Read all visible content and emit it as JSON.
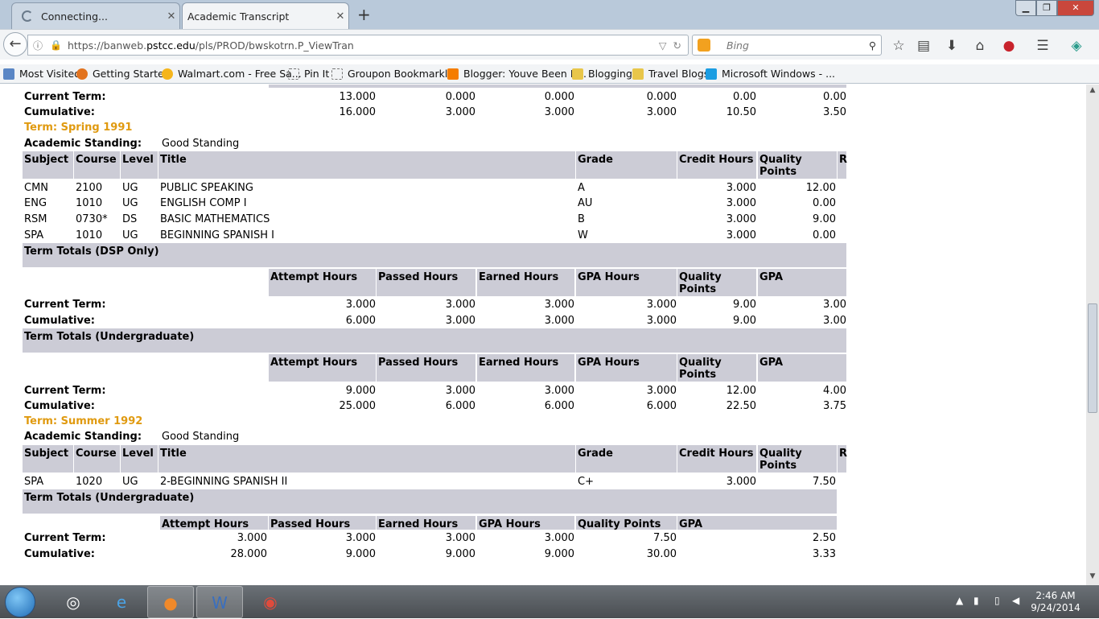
{
  "browser": {
    "tabs": [
      {
        "label": "Connecting...",
        "active": false
      },
      {
        "label": "Academic Transcript",
        "active": true
      }
    ],
    "url_prefix": "https://banweb.",
    "url_domain": "pstcc.edu",
    "url_path": "/pls/PROD/bwskotrn.P_ViewTran",
    "search_placeholder": "Bing",
    "bookmarks": [
      "Most Visited",
      "Getting Started",
      "Walmart.com - Free Sa...",
      "Pin It",
      "Groupon Bookmarklet",
      "Blogger: Youve Been R...",
      "Blogging",
      "Travel Blogs",
      "Microsoft Windows - ..."
    ]
  },
  "transcript": {
    "top_totals": {
      "current_label": "Current Term:",
      "current": [
        "13.000",
        "0.000",
        "0.000",
        "0.000",
        "0.00",
        "0.00"
      ],
      "cumulative_label": "Cumulative:",
      "cumulative": [
        "16.000",
        "3.000",
        "3.000",
        "3.000",
        "10.50",
        "3.50"
      ]
    },
    "terms": [
      {
        "name": "Term: Spring 1991",
        "standing_label": "Academic Standing:",
        "standing": "Good Standing",
        "course_headers": [
          "Subject",
          "Course",
          "Level",
          "Title",
          "Grade",
          "Credit Hours",
          "Quality Points",
          "R"
        ],
        "courses": [
          {
            "subject": "CMN",
            "course": "2100",
            "level": "UG",
            "title": "PUBLIC SPEAKING",
            "grade": "A",
            "credit": "3.000",
            "quality": "12.00"
          },
          {
            "subject": "ENG",
            "course": "1010",
            "level": "UG",
            "title": "ENGLISH COMP I",
            "grade": "AU",
            "credit": "3.000",
            "quality": "0.00"
          },
          {
            "subject": "RSM",
            "course": "0730*",
            "level": "DS",
            "title": "BASIC MATHEMATICS",
            "grade": "B",
            "credit": "3.000",
            "quality": "9.00"
          },
          {
            "subject": "SPA",
            "course": "1010",
            "level": "UG",
            "title": "BEGINNING SPANISH I",
            "grade": "W",
            "credit": "3.000",
            "quality": "0.00"
          }
        ],
        "totals": [
          {
            "title": "Term Totals (DSP Only)",
            "headers": [
              "Attempt Hours",
              "Passed Hours",
              "Earned Hours",
              "GPA Hours",
              "Quality Points",
              "GPA"
            ],
            "current_label": "Current Term:",
            "current": [
              "3.000",
              "3.000",
              "3.000",
              "3.000",
              "9.00",
              "3.00"
            ],
            "cumulative_label": "Cumulative:",
            "cumulative": [
              "6.000",
              "3.000",
              "3.000",
              "3.000",
              "9.00",
              "3.00"
            ]
          },
          {
            "title": "Term Totals (Undergraduate)",
            "headers": [
              "Attempt Hours",
              "Passed Hours",
              "Earned Hours",
              "GPA Hours",
              "Quality Points",
              "GPA"
            ],
            "current_label": "Current Term:",
            "current": [
              "9.000",
              "3.000",
              "3.000",
              "3.000",
              "12.00",
              "4.00"
            ],
            "cumulative_label": "Cumulative:",
            "cumulative": [
              "25.000",
              "6.000",
              "6.000",
              "6.000",
              "22.50",
              "3.75"
            ]
          }
        ]
      },
      {
        "name": "Term: Summer 1992",
        "standing_label": "Academic Standing:",
        "standing": "Good Standing",
        "course_headers": [
          "Subject",
          "Course",
          "Level",
          "Title",
          "Grade",
          "Credit Hours",
          "Quality Points",
          "R"
        ],
        "courses": [
          {
            "subject": "SPA",
            "course": "1020",
            "level": "UG",
            "title": "2-BEGINNING SPANISH II",
            "grade": "C+",
            "credit": "3.000",
            "quality": "7.50"
          }
        ],
        "totals": [
          {
            "title": "Term Totals (Undergraduate)",
            "headers": [
              "Attempt Hours",
              "Passed Hours",
              "Earned Hours",
              "GPA Hours",
              "Quality Points",
              "GPA"
            ],
            "current_label": "Current Term:",
            "current": [
              "3.000",
              "3.000",
              "3.000",
              "3.000",
              "7.50",
              "2.50"
            ],
            "cumulative_label": "Cumulative:",
            "cumulative": [
              "28.000",
              "9.000",
              "9.000",
              "9.000",
              "30.00",
              "3.33"
            ]
          }
        ]
      }
    ]
  },
  "taskbar": {
    "time": "2:46 AM",
    "date": "9/24/2014"
  },
  "colors": {
    "term_heading": "#e09a10",
    "header_bg": "#ccccd6"
  }
}
